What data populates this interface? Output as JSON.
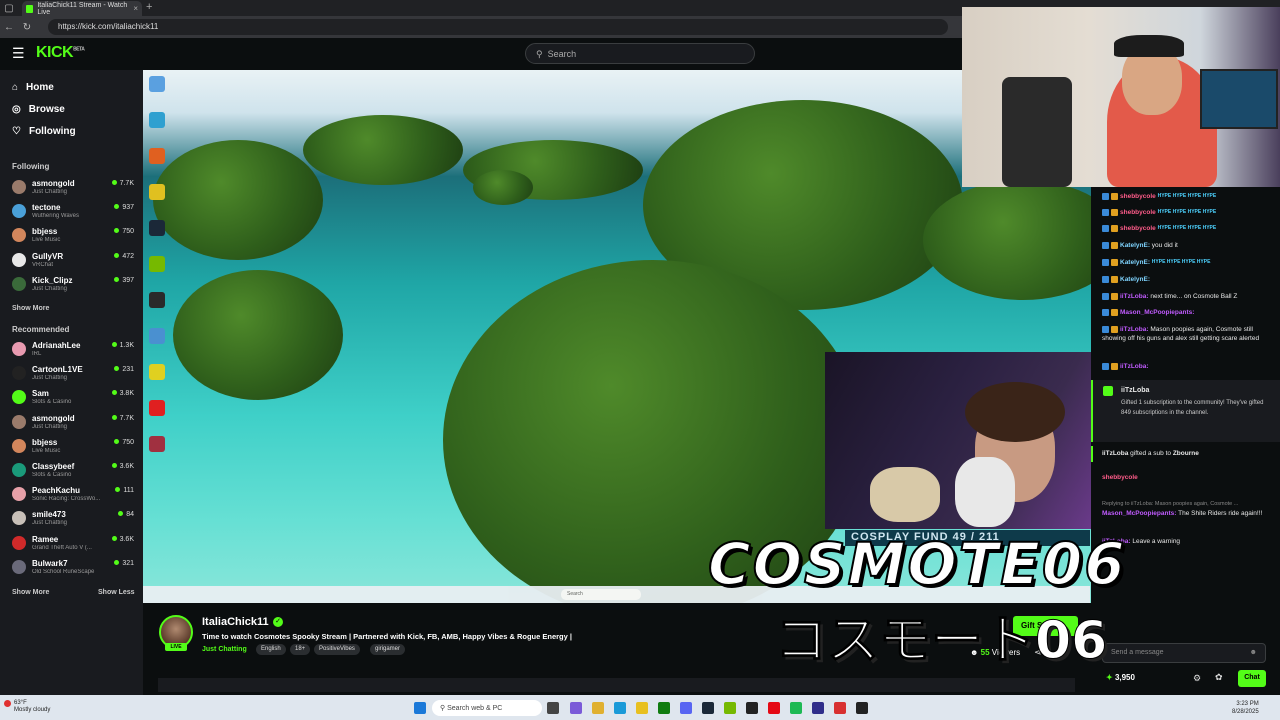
{
  "browser": {
    "tab_title": "ItaliaChick11 Stream - Watch Live",
    "new_tab": "+",
    "url": "https://kick.com/italiachick11"
  },
  "header": {
    "logo": "KICK",
    "logo_sup": "BETA",
    "search_placeholder": "Search"
  },
  "sidebar": {
    "nav": [
      {
        "label": "Home",
        "icon": "home-icon"
      },
      {
        "label": "Browse",
        "icon": "compass-icon"
      },
      {
        "label": "Following",
        "icon": "heart-icon"
      }
    ],
    "following_title": "Following",
    "following": [
      {
        "name": "asmongold",
        "category": "Just Chatting",
        "viewers": "7.7K",
        "color": "#9a7b6b"
      },
      {
        "name": "tectone",
        "category": "Wuthering Waves",
        "viewers": "937",
        "color": "#4aa0d8"
      },
      {
        "name": "bbjess",
        "category": "Live Music",
        "viewers": "750",
        "color": "#d2865c"
      },
      {
        "name": "GullyVR",
        "category": "VRChat",
        "viewers": "472",
        "color": "#e8e8e8"
      },
      {
        "name": "Kick_Clipz",
        "category": "Just Chatting",
        "viewers": "397",
        "color": "#3a6a3a"
      }
    ],
    "show_more_1": "Show More",
    "recommended_title": "Recommended",
    "recommended": [
      {
        "name": "AdrianahLee",
        "category": "IRL",
        "viewers": "1.3K",
        "color": "#e89ab0"
      },
      {
        "name": "CartoonL1VE",
        "category": "Just Chatting",
        "viewers": "231",
        "color": "#222222"
      },
      {
        "name": "Sam",
        "category": "Slots & Casino",
        "viewers": "3.8K",
        "color": "#53fc18"
      },
      {
        "name": "asmongold",
        "category": "Just Chatting",
        "viewers": "7.7K",
        "color": "#9a7b6b"
      },
      {
        "name": "bbjess",
        "category": "Live Music",
        "viewers": "750",
        "color": "#d2865c"
      },
      {
        "name": "Classybeef",
        "category": "Slots & Casino",
        "viewers": "3.6K",
        "color": "#1a9a7a"
      },
      {
        "name": "PeachKachu",
        "category": "Sonic Racing: CrossWo...",
        "viewers": "111",
        "color": "#e6a0a8"
      },
      {
        "name": "smile473",
        "category": "Just Chatting",
        "viewers": "84",
        "color": "#c8c0b8"
      },
      {
        "name": "Ramee",
        "category": "Grand Theft Auto V (...",
        "viewers": "3.6K",
        "color": "#d02a2a"
      },
      {
        "name": "Bulwark7",
        "category": "Old School RuneScape",
        "viewers": "321",
        "color": "#6a6a7a"
      }
    ],
    "show_more_2": "Show More",
    "show_less": "Show Less"
  },
  "stream": {
    "streamer": "ItaliaChick11",
    "live": "LIVE",
    "title": "Time to watch Cosmotes Spooky Stream | Partnered with Kick, FB, AMB, Happy Vibes & Rogue Energy |",
    "category": "Just Chatting",
    "tags": [
      "English",
      "18+",
      "PositiveVibes",
      "girigamer"
    ],
    "viewers_count": "55",
    "viewers_label": "Viewers",
    "gift_button": "Gift Subs"
  },
  "overlay": {
    "name_latin": "COSMOTE06",
    "name_katakana": "コスモート06",
    "fund": "COSPLAY FUND  49 / 211"
  },
  "chat": {
    "messages": [
      {
        "user": "shebbycole",
        "text": "",
        "color": "#ff5c8a",
        "hype": true
      },
      {
        "user": "shebbycole",
        "text": "",
        "color": "#ff5c8a",
        "hype": true
      },
      {
        "user": "shebbycole",
        "text": "",
        "color": "#ff5c8a",
        "hype": true
      },
      {
        "user": "KatelynE:",
        "text": "you did it",
        "color": "#7fd4ff",
        "hype": false
      },
      {
        "user": "KatelynE:",
        "text": "",
        "color": "#7fd4ff",
        "hype": true
      },
      {
        "user": "KatelynE:",
        "text": "",
        "color": "#7fd4ff",
        "hype": false
      },
      {
        "user": "iiTzLoba:",
        "text": "next time... on Cosmote Ball Z",
        "color": "#c15bff",
        "hype": false
      },
      {
        "user": "Mason_McPoopiepants:",
        "text": "",
        "color": "#c15bff",
        "hype": false
      },
      {
        "user": "iiTzLoba:",
        "text": "Mason poopies again, Cosmote still showing off his guns and alex still getting scare alerted",
        "color": "#c15bff",
        "hype": false
      },
      {
        "user": "iiTzLoba:",
        "text": "",
        "color": "#c15bff",
        "hype": false
      }
    ],
    "gift_user": "iiTzLoba",
    "gift_text": "Gifted 1 subscription to the community! They've gifted 849 subscriptions in the channel.",
    "gift2_user": "iiTzLoba",
    "gift2_mid": "gifted a sub to",
    "gift2_target": "Zbourne",
    "after": [
      {
        "user": "shebbycole",
        "text": "",
        "color": "#ff5c8a"
      },
      {
        "user": "Mason_McPoopiepants:",
        "text": "The Shite Riders ride again!!!",
        "color": "#c15bff",
        "reply": "Replying to iiTzLoba: Mason poopies again, Cosmote ..."
      },
      {
        "user": "iiTzLoba:",
        "text": "Leave a warning",
        "color": "#c15bff"
      }
    ],
    "hype_word": "HYPE HYPE HYPE HYPE",
    "input_placeholder": "Send a message",
    "points": "3,950",
    "chat_button": "Chat"
  },
  "os": {
    "weather_temp": "63°F",
    "weather_desc": "Mostly cloudy",
    "search": "Search web & PC",
    "time": "3:23 PM",
    "date": "8/28/2025"
  },
  "desktop": {
    "search": "Search"
  }
}
